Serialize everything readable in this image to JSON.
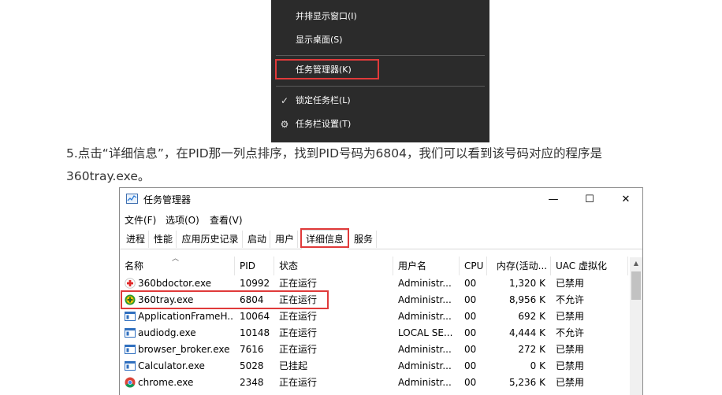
{
  "context_menu": {
    "items": [
      {
        "label": "并排显示窗口(I)"
      },
      {
        "label": "显示桌面(S)"
      },
      {
        "label": "任务管理器(K)"
      },
      {
        "label": "锁定任务栏(L)",
        "icon": "checkmark-icon"
      },
      {
        "label": "任务栏设置(T)",
        "icon": "gear-icon"
      }
    ]
  },
  "article": {
    "step_text": "5.点击“详细信息”，在PID那一列点排序，找到PID号码为6804，我们可以看到该号码对应的程序是360tray.exe。"
  },
  "task_manager": {
    "title": "任务管理器",
    "window_buttons": {
      "minimize": "—",
      "maximize": "☐",
      "close": "✕"
    },
    "menu": [
      "文件(F)",
      "选项(O)",
      "查看(V)"
    ],
    "tabs": [
      "进程",
      "性能",
      "应用历史记录",
      "启动",
      "用户",
      "详细信息",
      "服务"
    ],
    "active_tab": "详细信息",
    "columns": [
      "名称",
      "PID",
      "状态",
      "用户名",
      "CPU",
      "内存(活动...",
      "UAC 虚拟化"
    ],
    "rows": [
      {
        "name": "360bdoctor.exe",
        "pid": "10992",
        "status": "正在运行",
        "user": "Administr...",
        "cpu": "00",
        "mem": "1,320 K",
        "uac": "已禁用",
        "icon": "doctor-cross-icon"
      },
      {
        "name": "360tray.exe",
        "pid": "6804",
        "status": "正在运行",
        "user": "Administr...",
        "cpu": "00",
        "mem": "8,956 K",
        "uac": "不允许",
        "icon": "360-shield-icon"
      },
      {
        "name": "ApplicationFrameH...",
        "pid": "10064",
        "status": "正在运行",
        "user": "Administr...",
        "cpu": "00",
        "mem": "692 K",
        "uac": "已禁用",
        "icon": "app-window-icon"
      },
      {
        "name": "audiodg.exe",
        "pid": "10148",
        "status": "正在运行",
        "user": "LOCAL SE...",
        "cpu": "00",
        "mem": "4,444 K",
        "uac": "不允许",
        "icon": "app-window-icon"
      },
      {
        "name": "browser_broker.exe",
        "pid": "7616",
        "status": "正在运行",
        "user": "Administr...",
        "cpu": "00",
        "mem": "272 K",
        "uac": "已禁用",
        "icon": "app-window-icon"
      },
      {
        "name": "Calculator.exe",
        "pid": "5028",
        "status": "已挂起",
        "user": "Administr...",
        "cpu": "00",
        "mem": "0 K",
        "uac": "已禁用",
        "icon": "app-window-icon"
      },
      {
        "name": "chrome.exe",
        "pid": "2348",
        "status": "正在运行",
        "user": "Administr...",
        "cpu": "00",
        "mem": "5,236 K",
        "uac": "已禁用",
        "icon": "chrome-icon"
      }
    ]
  },
  "colors": {
    "highlight_red": "#e03a3a",
    "menu_bg": "#2b2b2b",
    "text": "#333333"
  }
}
